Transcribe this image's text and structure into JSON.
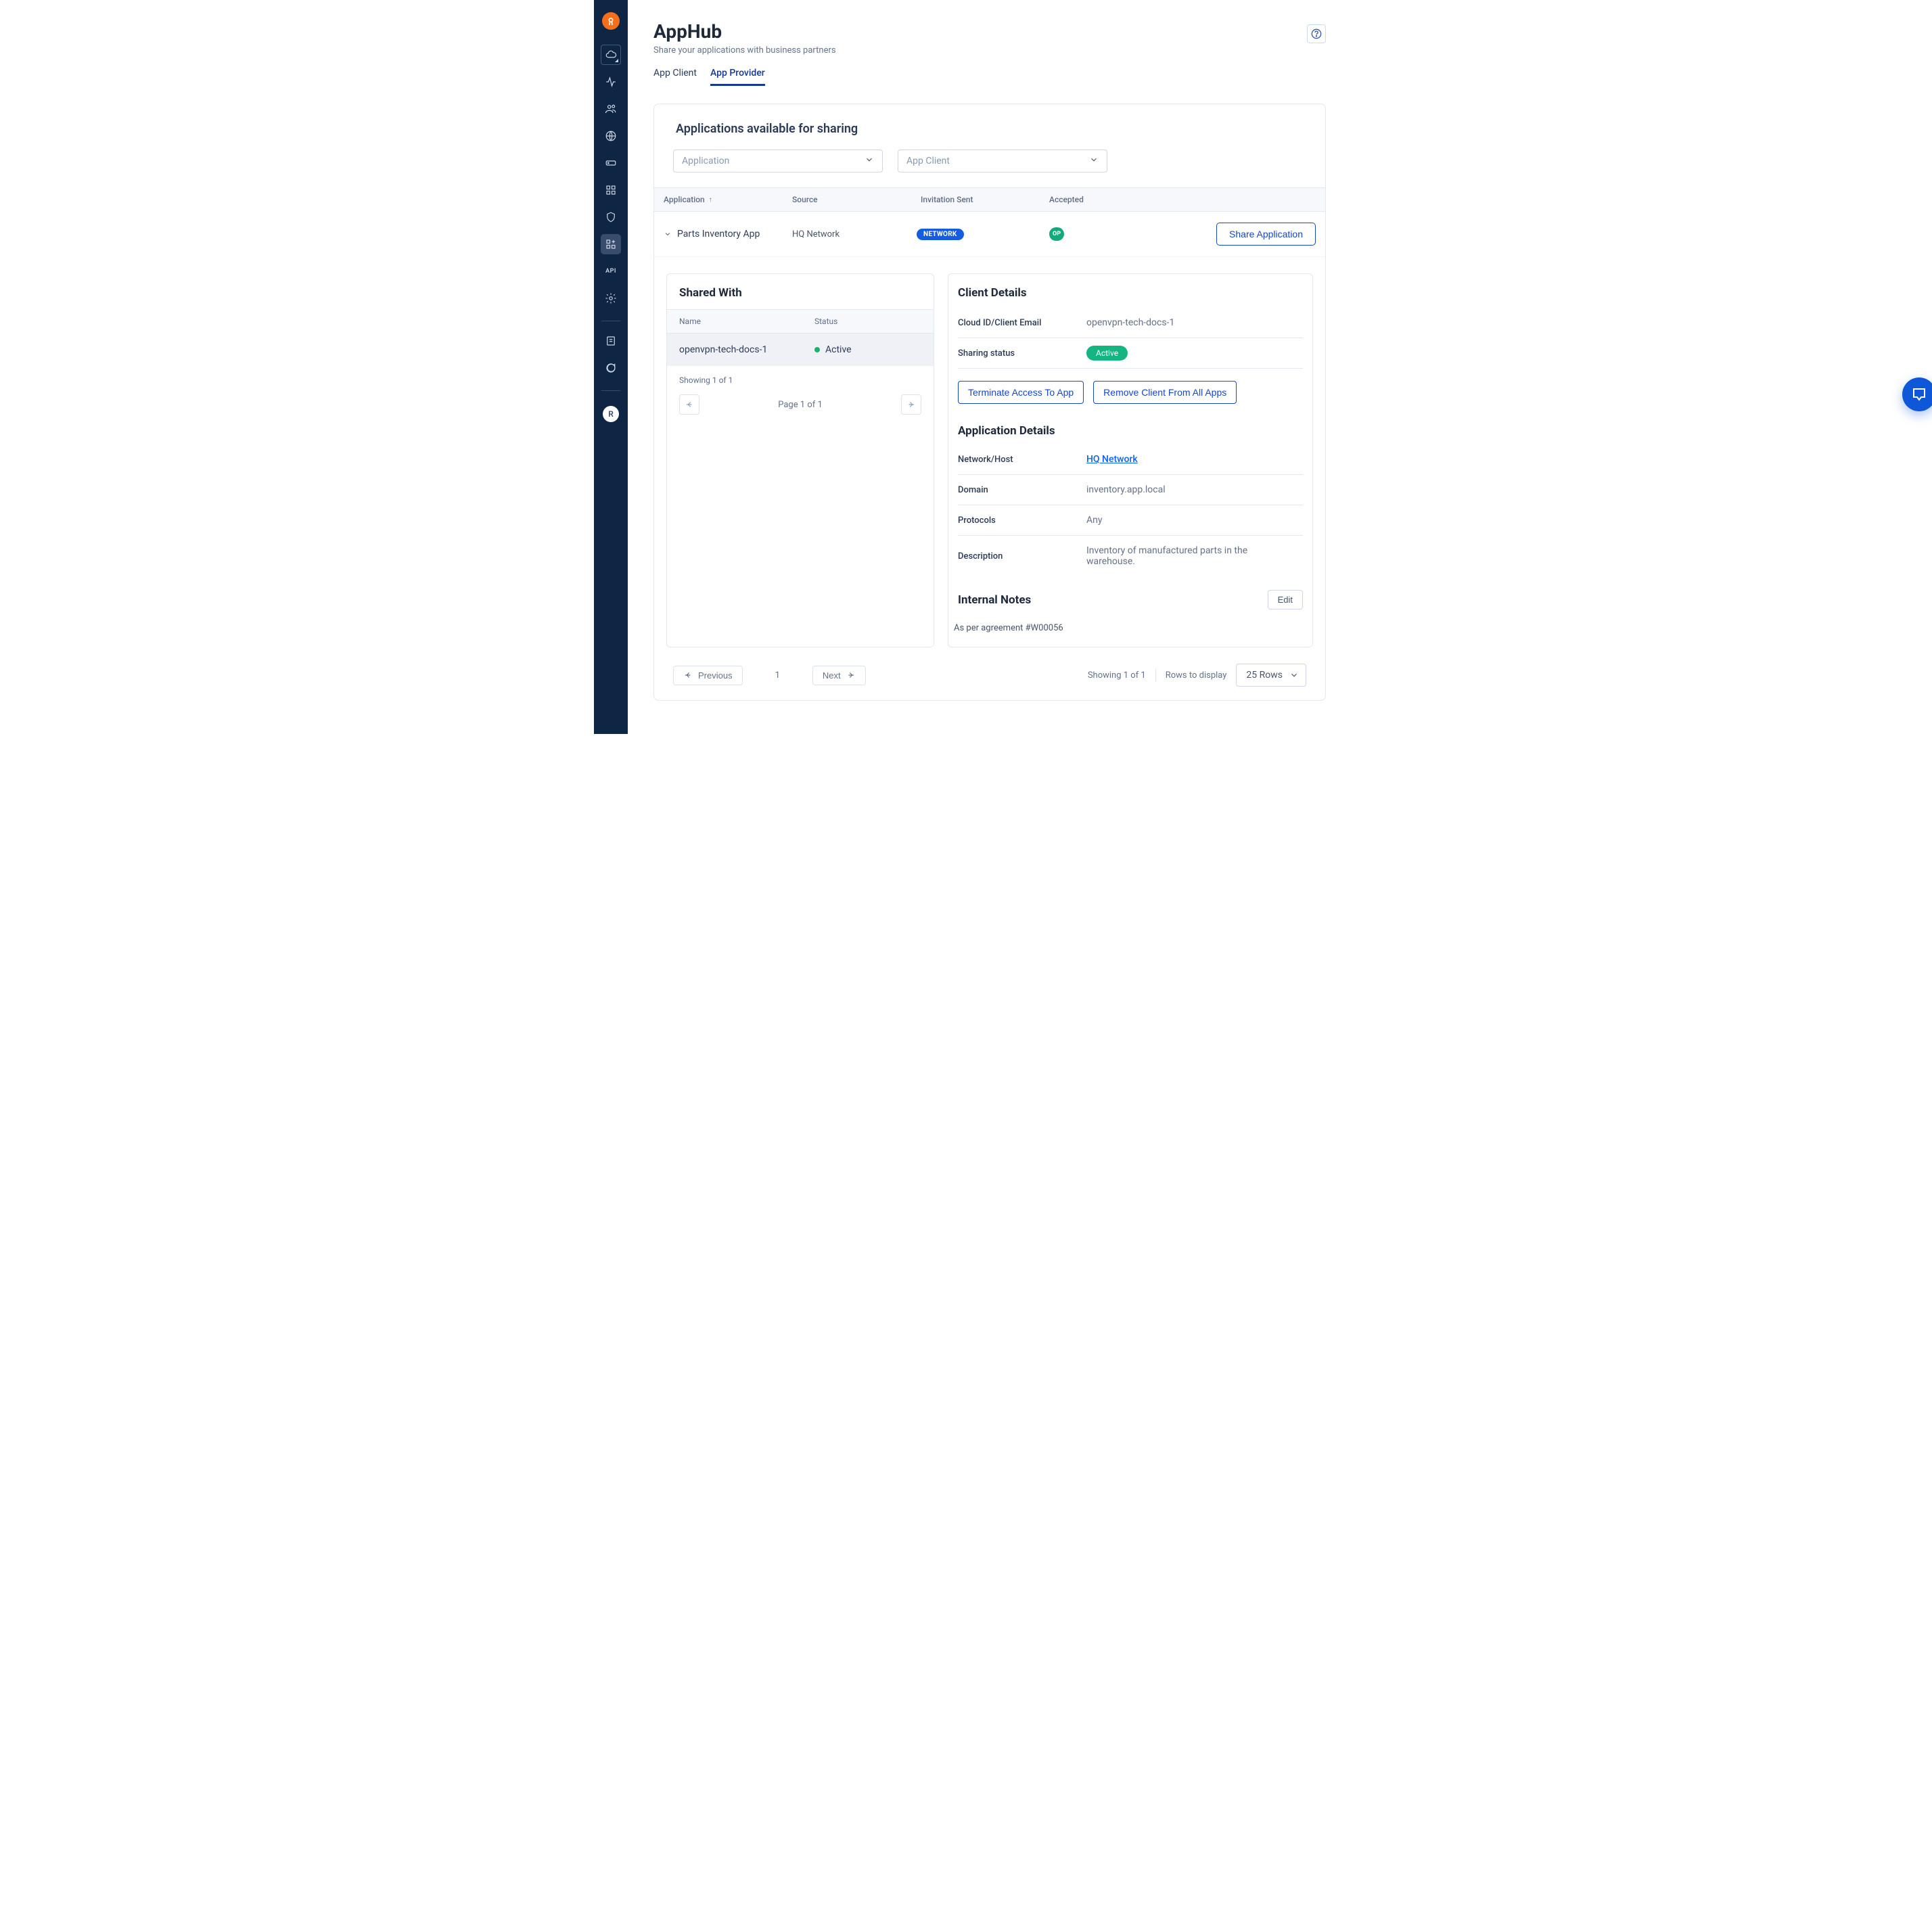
{
  "sidebar": {
    "avatar_initial": "R"
  },
  "header": {
    "title": "AppHub",
    "subtitle": "Share your applications with business partners"
  },
  "tabs": {
    "client": "App Client",
    "provider": "App Provider"
  },
  "section": {
    "available_title": "Applications available for sharing"
  },
  "filters": {
    "app_placeholder": "Application",
    "client_placeholder": "App Client"
  },
  "table": {
    "headers": {
      "application": "Application",
      "source": "Source",
      "invitation": "Invitation Sent",
      "accepted": "Accepted"
    },
    "row": {
      "app": "Parts Inventory App",
      "source": "HQ Network",
      "source_badge": "NETWORK",
      "accepted_badge": "OP",
      "share_btn": "Share Application"
    }
  },
  "shared": {
    "title": "Shared With",
    "headers": {
      "name": "Name",
      "status": "Status"
    },
    "row": {
      "name": "openvpn-tech-docs-1",
      "status": "Active"
    },
    "showing": "Showing 1 of 1",
    "page_label": "Page 1 of 1"
  },
  "client_details": {
    "title": "Client Details",
    "id_label": "Cloud ID/Client Email",
    "id_value": "openvpn-tech-docs-1",
    "status_label": "Sharing status",
    "status_value": "Active",
    "terminate_btn": "Terminate Access To App",
    "remove_btn": "Remove Client From All Apps"
  },
  "app_details": {
    "title": "Application Details",
    "network_label": "Network/Host",
    "network_value": "HQ Network",
    "domain_label": "Domain",
    "domain_value": "inventory.app.local",
    "protocols_label": "Protocols",
    "protocols_value": "Any",
    "desc_label": "Description",
    "desc_value": "Inventory of manufactured parts in the warehouse."
  },
  "notes": {
    "title": "Internal Notes",
    "edit": "Edit",
    "body": "As per agreement #W00056"
  },
  "footer": {
    "previous": "Previous",
    "next": "Next",
    "page_index": "1",
    "showing": "Showing 1 of 1",
    "rows_label": "Rows to display",
    "rows_value": "25 Rows"
  }
}
